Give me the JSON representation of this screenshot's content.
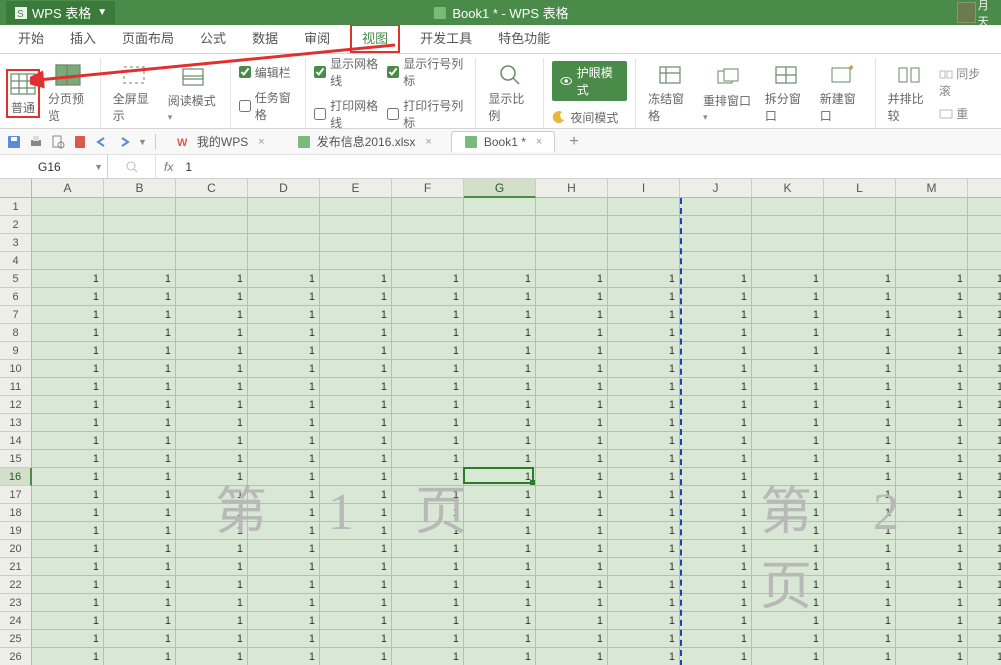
{
  "title": {
    "app_name": "WPS 表格",
    "doc_name": "Book1 * - WPS 表格",
    "user_name": "月天"
  },
  "menu": {
    "items": [
      "开始",
      "插入",
      "页面布局",
      "公式",
      "数据",
      "审阅",
      "视图",
      "开发工具",
      "特色功能"
    ],
    "active_index": 6
  },
  "ribbon": {
    "normal_view": "普通",
    "page_break_preview": "分页预览",
    "fullscreen": "全屏显示",
    "reading_mode": "阅读模式",
    "chk_formula_bar": "编辑栏",
    "chk_task_pane": "任务窗格",
    "chk_gridlines": "显示网格线",
    "chk_print_grid": "打印网格线",
    "chk_headings": "显示行号列标",
    "chk_print_head": "打印行号列标",
    "zoom": "显示比例",
    "eye_protect": "护眼模式",
    "night_mode": "夜间模式",
    "freeze": "冻结窗格",
    "arrange": "重排窗口",
    "split": "拆分窗口",
    "new_window": "新建窗口",
    "side_by_side": "并排比较",
    "sync_scroll": "同步滚",
    "reset_pos": "重"
  },
  "qat": {
    "tab_mywps": "我的WPS",
    "tab_file1": "发布信息2016.xlsx",
    "tab_active": "Book1 *"
  },
  "formula": {
    "namebox": "G16",
    "fx": "fx",
    "value": "1"
  },
  "grid": {
    "columns": [
      "A",
      "B",
      "C",
      "D",
      "E",
      "F",
      "G",
      "H",
      "I",
      "J",
      "K",
      "L",
      "M"
    ],
    "row_start": 1,
    "row_end": 26,
    "data_row_start": 5,
    "cell_value": "1",
    "active_col": "G",
    "active_row": 16,
    "pagebreak_after_col": "I",
    "watermark_page1": "第 1 页",
    "watermark_page2": "第 2 页"
  }
}
